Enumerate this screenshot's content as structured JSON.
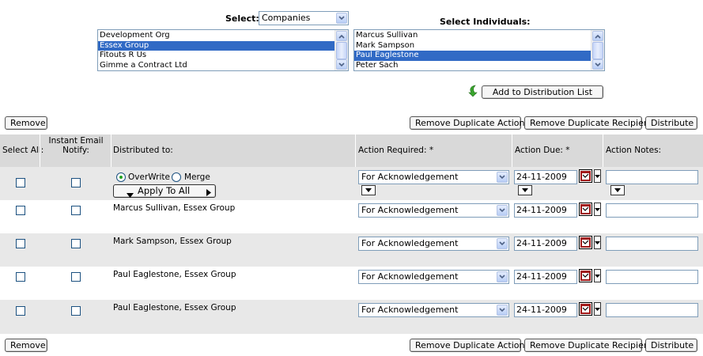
{
  "select_area": {
    "select_label": "Select:",
    "select_value": "Companies",
    "companies": [
      {
        "label": "Development Org",
        "selected": false
      },
      {
        "label": "Essex Group",
        "selected": true
      },
      {
        "label": "Fitouts R Us",
        "selected": false
      },
      {
        "label": "Gimme a Contract Ltd",
        "selected": false
      }
    ],
    "individuals_label": "Select Individuals:",
    "individuals": [
      {
        "label": "Marcus Sullivan",
        "selected": false
      },
      {
        "label": "Mark Sampson",
        "selected": false
      },
      {
        "label": "Paul Eaglestone",
        "selected": true
      },
      {
        "label": "Peter Sach",
        "selected": false
      }
    ],
    "add_button": "Add to Distribution List"
  },
  "toolbar": {
    "remove": "Remove",
    "remove_duplicate_actions": "Remove Duplicate Actions",
    "remove_duplicate_recipients": "Remove Duplicate Recipients",
    "distribute": "Distribute"
  },
  "table": {
    "headers": {
      "select_all": "Select All:",
      "instant_email": "Instant Email Notify:",
      "distributed_to": "Distributed to:",
      "action_required": "Action Required: *",
      "action_due": "Action Due: *",
      "action_notes": "Action Notes:"
    },
    "apply_row": {
      "overwrite": "OverWrite",
      "merge": "Merge",
      "apply_to_all": "Apply To All",
      "action_required": "For Acknowledgement",
      "action_due": "24-11-2009",
      "mode": "OverWrite"
    },
    "rows": [
      {
        "name": "Marcus Sullivan, Essex Group",
        "action_required": "For Acknowledgement",
        "action_due": "24-11-2009"
      },
      {
        "name": "Mark Sampson, Essex Group",
        "action_required": "For Acknowledgement",
        "action_due": "24-11-2009"
      },
      {
        "name": "Paul Eaglestone, Essex Group",
        "action_required": "For Acknowledgement",
        "action_due": "24-11-2009"
      },
      {
        "name": "Paul Eaglestone, Essex Group",
        "action_required": "For Acknowledgement",
        "action_due": "24-11-2009"
      }
    ]
  },
  "colors": {
    "selection": "#316ac5",
    "header_bg": "#d9d9d9",
    "alt_row_bg": "#e8e8e8",
    "add_arrow": "#3aa62e"
  }
}
